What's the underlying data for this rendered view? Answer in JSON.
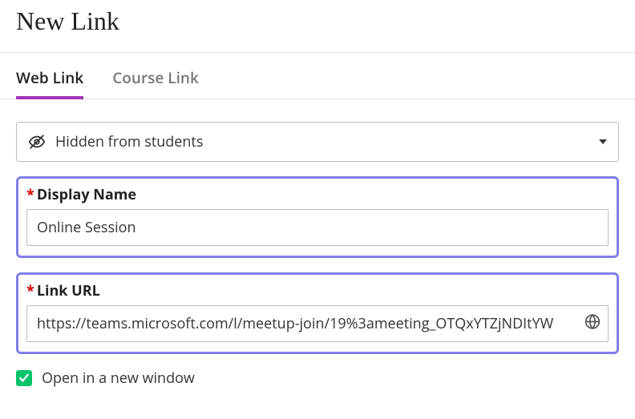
{
  "page_title": "New Link",
  "tabs": {
    "web": "Web Link",
    "course": "Course Link",
    "active": "web"
  },
  "visibility": {
    "selected_label": "Hidden from students"
  },
  "fields": {
    "display_name": {
      "label": "Display Name",
      "required": true,
      "value": "Online Session"
    },
    "link_url": {
      "label": "Link URL",
      "required": true,
      "value": "https://teams.microsoft.com/l/meetup-join/19%3ameeting_OTQxYTZjNDItYW"
    }
  },
  "open_new_window": {
    "label": "Open in a new window",
    "checked": true
  },
  "required_marker": "*"
}
